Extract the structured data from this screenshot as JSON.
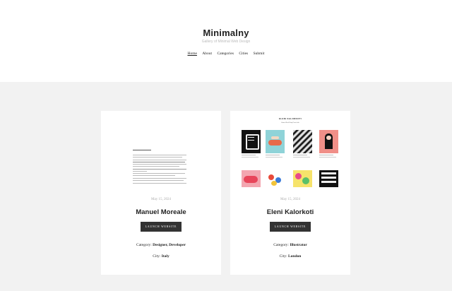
{
  "site": {
    "title": "Minimalny",
    "tagline": "Gallery of Minimal Web Design"
  },
  "nav": {
    "items": [
      "Home",
      "About",
      "Categories",
      "Cities",
      "Submit"
    ],
    "active": "Home"
  },
  "cards": [
    {
      "date": "May 15, 2024",
      "name": "Manuel Moreale",
      "button_label": "LAUNCH WEBSITE",
      "category_label": "Category:",
      "category_value": "Designer, Developer",
      "city_label": "City:",
      "city_value": "Italy"
    },
    {
      "date": "May 15, 2024",
      "name": "Eleni Kalorkoti",
      "button_label": "LAUNCH WEBSITE",
      "category_label": "Category:",
      "category_value": "Illustrator",
      "city_label": "City:",
      "city_value": "London",
      "thumbnail": {
        "title": "ELENI KALORKOTI",
        "nav": "Home   Work   Shop   Prints   Info"
      }
    }
  ],
  "colors": {
    "background": "#f2f2f2",
    "button": "#333333",
    "text": "#222222"
  }
}
